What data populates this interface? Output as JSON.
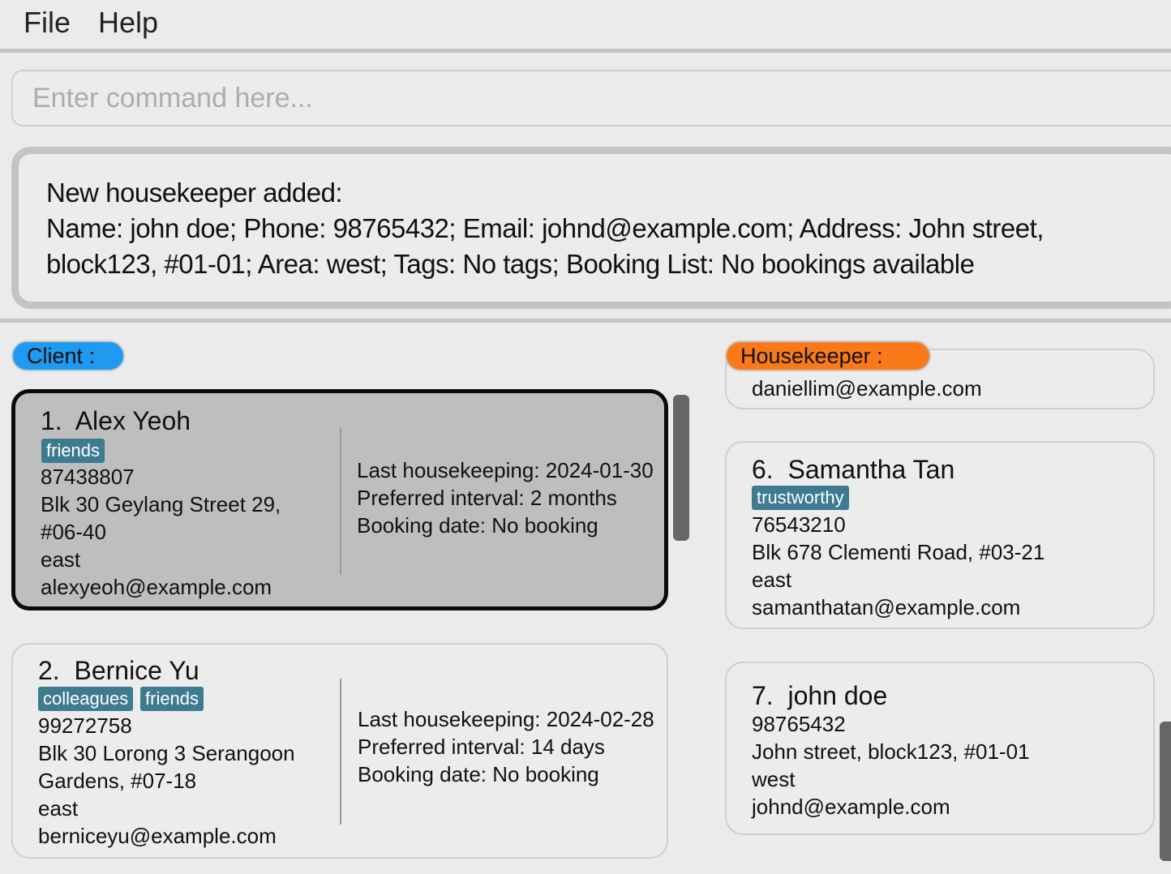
{
  "menu": {
    "file": "File",
    "help": "Help"
  },
  "command": {
    "placeholder": "Enter command here...",
    "value": ""
  },
  "result": {
    "lines": [
      "New housekeeper added:",
      "Name: john doe; Phone: 98765432; Email: johnd@example.com; Address: John street,",
      "block123, #01-01; Area: west; Tags: No tags; Booking List: No bookings available"
    ]
  },
  "labels": {
    "client": "Client :",
    "housekeeper": "Housekeeper :"
  },
  "clients": [
    {
      "index": "1.",
      "name": "Alex Yeoh",
      "tags": [
        "friends"
      ],
      "phone": "87438807",
      "address_line1": "Blk 30 Geylang Street 29,",
      "address_line2": "#06-40",
      "area": "east",
      "email": "alexyeoh@example.com",
      "last_housekeeping": "Last housekeeping: 2024-01-30",
      "preferred_interval": "Preferred interval: 2 months",
      "booking_date": "Booking date: No booking"
    },
    {
      "index": "2.",
      "name": "Bernice Yu",
      "tags": [
        "colleagues",
        "friends"
      ],
      "phone": "99272758",
      "address_line1": "Blk 30 Lorong 3 Serangoon",
      "address_line2": "Gardens, #07-18",
      "area": "east",
      "email": "berniceyu@example.com",
      "last_housekeeping": "Last housekeeping: 2024-02-28",
      "preferred_interval": "Preferred interval: 14 days",
      "booking_date": "Booking date: No booking"
    }
  ],
  "housekeepers": [
    {
      "partial_email": "daniellim@example.com"
    },
    {
      "index": "6.",
      "name": "Samantha Tan",
      "tags": [
        "trustworthy"
      ],
      "phone": "76543210",
      "address": "Blk 678 Clementi Road, #03-21",
      "area": "east",
      "email": "samanthatan@example.com"
    },
    {
      "index": "7.",
      "name": "john doe",
      "tags": [],
      "phone": "98765432",
      "address": "John street, block123, #01-01",
      "area": "west",
      "email": "johnd@example.com"
    }
  ]
}
